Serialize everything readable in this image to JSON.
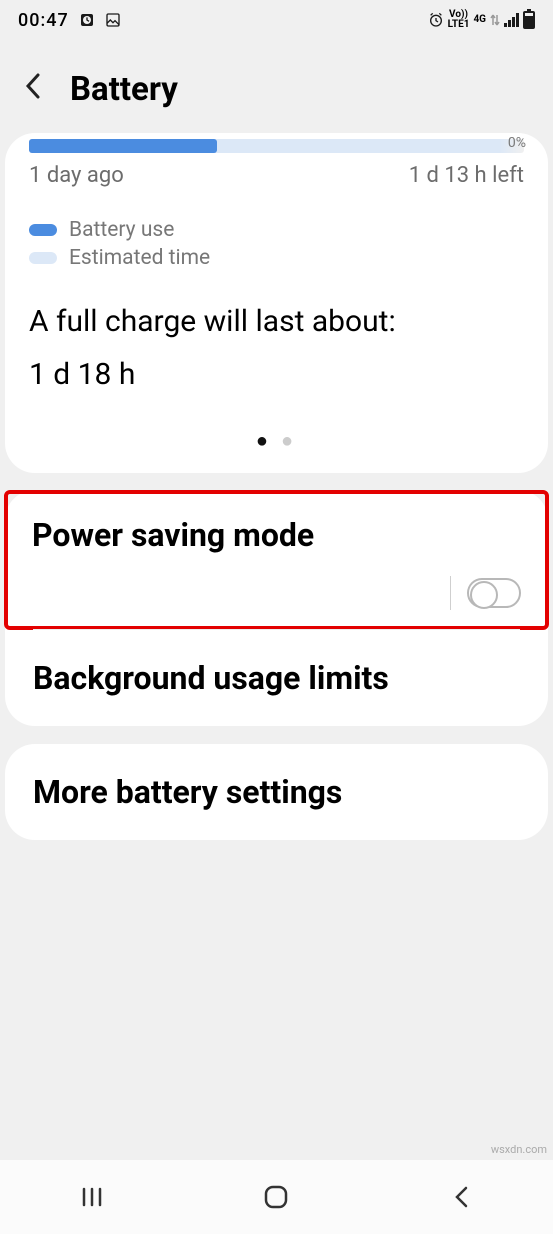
{
  "statusbar": {
    "time": "00:47",
    "network_type": "4G",
    "network_label": "Vo))\nLTE1"
  },
  "header": {
    "title": "Battery"
  },
  "battery": {
    "percent_label": "0%",
    "fill_percent": 38,
    "time_ago": "1 day ago",
    "time_left": "1 d 13 h left",
    "legend_use": "Battery use",
    "legend_est": "Estimated time",
    "full_charge_label": "A full charge will last about:",
    "full_charge_value": "1 d 18 h"
  },
  "settings": {
    "power_saving": "Power saving mode",
    "background_limits": "Background usage limits",
    "more": "More battery settings"
  },
  "watermark": "wsxdn.com"
}
